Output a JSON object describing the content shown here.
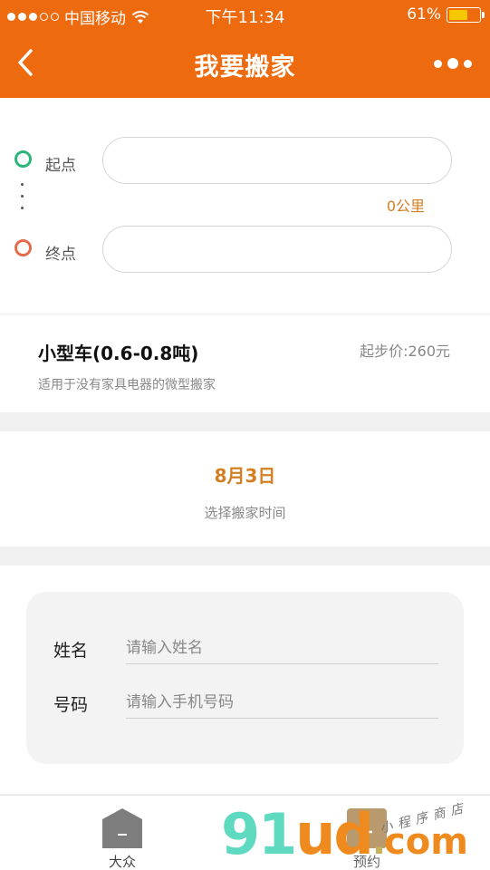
{
  "status": {
    "carrier": "中国移动",
    "time": "下午11:34",
    "battery_percent": "61%",
    "battery_level": 0.61
  },
  "header": {
    "title": "我要搬家"
  },
  "route": {
    "start_label": "起点",
    "end_label": "终点",
    "start_value": "",
    "end_value": "",
    "distance": "0公里"
  },
  "vehicle": {
    "name": "小型车(0.6-0.8吨)",
    "price": "起步价:260元",
    "description": "适用于没有家具电器的微型搬家"
  },
  "schedule": {
    "date": "8月3日",
    "hint": "选择搬家时间"
  },
  "contact": {
    "name_label": "姓名",
    "name_placeholder": "请输入姓名",
    "phone_label": "号码",
    "phone_placeholder": "请输入手机号码"
  },
  "tabs": [
    {
      "label": "大众",
      "icon": "house-icon"
    },
    {
      "label": "预约",
      "icon": "clock-icon"
    }
  ],
  "watermark": {
    "logo_text": "91ud.com",
    "script_text": "小程序商店"
  },
  "colors": {
    "brand": "#ee6a0f",
    "accent_text": "#d47f22",
    "start_dot": "#2cb67a",
    "end_dot": "#e46c4d"
  }
}
